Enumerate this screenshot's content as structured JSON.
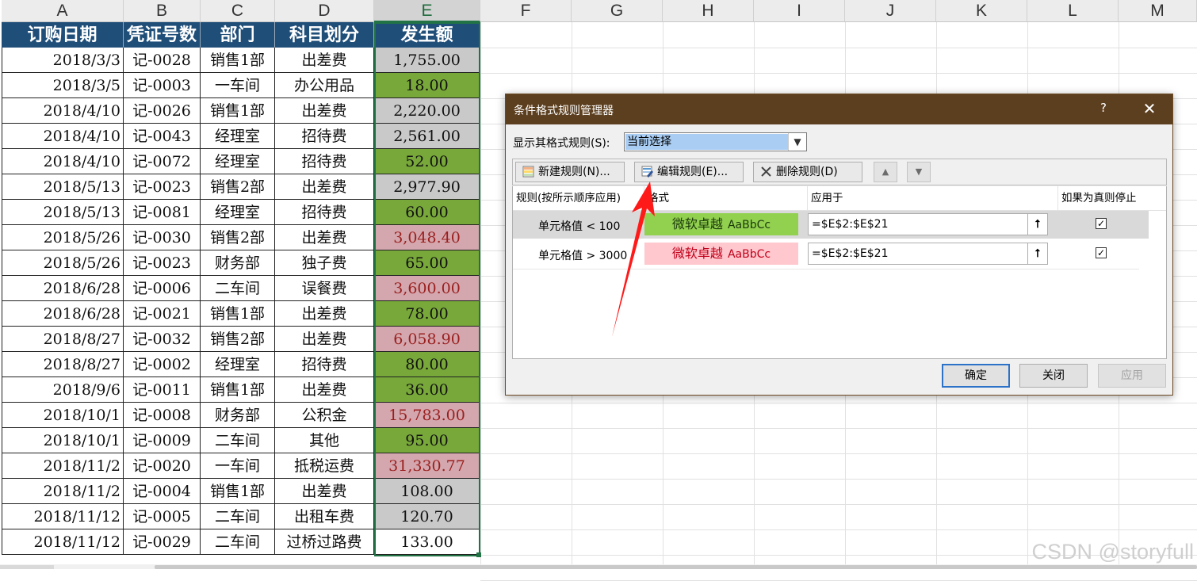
{
  "columns": [
    "A",
    "B",
    "C",
    "D",
    "E",
    "F",
    "G",
    "H",
    "I",
    "J",
    "K",
    "L",
    "M"
  ],
  "table": {
    "headers": [
      "订购日期",
      "凭证号数",
      "部门",
      "科目划分",
      "发生额"
    ],
    "rows": [
      {
        "date": "2018/3/3",
        "voucher": "记-0028",
        "dept": "销售1部",
        "category": "出差费",
        "amount": "1,755.00",
        "fill": "gray"
      },
      {
        "date": "2018/3/5",
        "voucher": "记-0003",
        "dept": "一车间",
        "category": "办公用品",
        "amount": "18.00",
        "fill": "green"
      },
      {
        "date": "2018/4/10",
        "voucher": "记-0026",
        "dept": "销售1部",
        "category": "出差费",
        "amount": "2,220.00",
        "fill": "gray"
      },
      {
        "date": "2018/4/10",
        "voucher": "记-0043",
        "dept": "经理室",
        "category": "招待费",
        "amount": "2,561.00",
        "fill": "gray"
      },
      {
        "date": "2018/4/10",
        "voucher": "记-0072",
        "dept": "经理室",
        "category": "招待费",
        "amount": "52.00",
        "fill": "green"
      },
      {
        "date": "2018/5/13",
        "voucher": "记-0023",
        "dept": "销售2部",
        "category": "出差费",
        "amount": "2,977.90",
        "fill": "gray"
      },
      {
        "date": "2018/5/13",
        "voucher": "记-0081",
        "dept": "经理室",
        "category": "招待费",
        "amount": "60.00",
        "fill": "green"
      },
      {
        "date": "2018/5/26",
        "voucher": "记-0030",
        "dept": "销售2部",
        "category": "出差费",
        "amount": "3,048.40",
        "fill": "red"
      },
      {
        "date": "2018/5/26",
        "voucher": "记-0023",
        "dept": "财务部",
        "category": "独子费",
        "amount": "65.00",
        "fill": "green"
      },
      {
        "date": "2018/6/28",
        "voucher": "记-0006",
        "dept": "二车间",
        "category": "误餐费",
        "amount": "3,600.00",
        "fill": "red"
      },
      {
        "date": "2018/6/28",
        "voucher": "记-0021",
        "dept": "销售1部",
        "category": "出差费",
        "amount": "78.00",
        "fill": "green"
      },
      {
        "date": "2018/8/27",
        "voucher": "记-0032",
        "dept": "销售2部",
        "category": "出差费",
        "amount": "6,058.90",
        "fill": "red"
      },
      {
        "date": "2018/8/27",
        "voucher": "记-0002",
        "dept": "经理室",
        "category": "招待费",
        "amount": "80.00",
        "fill": "green"
      },
      {
        "date": "2018/9/6",
        "voucher": "记-0011",
        "dept": "销售1部",
        "category": "出差费",
        "amount": "36.00",
        "fill": "green"
      },
      {
        "date": "2018/10/1",
        "voucher": "记-0008",
        "dept": "财务部",
        "category": "公积金",
        "amount": "15,783.00",
        "fill": "red"
      },
      {
        "date": "2018/10/1",
        "voucher": "记-0009",
        "dept": "二车间",
        "category": "其他",
        "amount": "95.00",
        "fill": "green"
      },
      {
        "date": "2018/11/2",
        "voucher": "记-0020",
        "dept": "一车间",
        "category": "抵税运费",
        "amount": "31,330.77",
        "fill": "red"
      },
      {
        "date": "2018/11/2",
        "voucher": "记-0004",
        "dept": "销售1部",
        "category": "出差费",
        "amount": "108.00",
        "fill": "gray"
      },
      {
        "date": "2018/11/12",
        "voucher": "记-0005",
        "dept": "二车间",
        "category": "出租车费",
        "amount": "120.70",
        "fill": "gray"
      },
      {
        "date": "2018/11/12",
        "voucher": "记-0029",
        "dept": "二车间",
        "category": "过桥过路费",
        "amount": "133.00",
        "fill": "none"
      }
    ]
  },
  "dialog": {
    "title": "条件格式规则管理器",
    "help": "?",
    "close": "✕",
    "show_label": "显示其格式规则(S):",
    "show_value": "当前选择",
    "toolbar": {
      "new_rule": "新建规则(N)...",
      "edit_rule": "编辑规则(E)...",
      "delete_rule": "删除规则(D)",
      "move_up": "▲",
      "move_down": "▼"
    },
    "columns": {
      "rule": "规则(按所示顺序应用)",
      "format": "格式",
      "applies": "应用于",
      "stop": "如果为真则停止"
    },
    "rules": [
      {
        "rule": "单元格值 < 100",
        "preview": "微软卓越",
        "sample": "AaBbCc",
        "applies": "=$E$2:$E$21",
        "stop": true,
        "bg": "#92d050",
        "fg": "#1a3a0a"
      },
      {
        "rule": "单元格值 > 3000",
        "preview": "微软卓越",
        "sample": "AaBbCc",
        "applies": "=$E$2:$E$21",
        "stop": true,
        "bg": "#ffc7ce",
        "fg": "#c0001a"
      }
    ],
    "buttons": {
      "ok": "确定",
      "close": "关闭",
      "apply": "应用"
    }
  },
  "colors": {
    "header_fill": "#1f4e79",
    "accent": "#217346",
    "arrow": "#ff1a1a"
  },
  "watermark": "CSDN @storyfull"
}
